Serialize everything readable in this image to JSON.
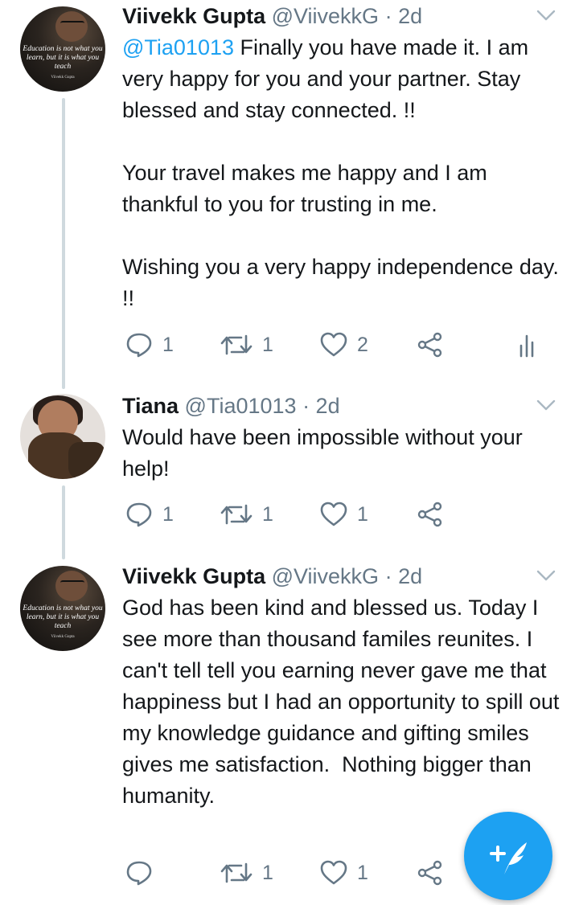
{
  "colors": {
    "accent": "#1da1f2",
    "muted": "#657786",
    "text": "#14171a",
    "thread_line": "#cfd9de"
  },
  "tweets": [
    {
      "name": "Viivekk Gupta",
      "handle": "@ViivekkG",
      "time": "· 2d",
      "mention": "@Tia01013",
      "text": " Finally you have made it. I am very happy for you and your partner. Stay blessed and stay connected. !!\n\nYour travel makes me happy and I am thankful to you for trusting in me.\n\nWishing you a very happy independence day. !!",
      "avatar_quote": "Education is not what you learn, but it is what you teach",
      "avatar_signature": "Viivekk Gupta",
      "replies": "1",
      "retweets": "1",
      "likes": "2",
      "icons": [
        "reply-icon",
        "retweet-icon",
        "like-icon",
        "share-icon",
        "analytics-icon"
      ]
    },
    {
      "name": "Tiana",
      "handle": "@Tia01013",
      "time": "· 2d",
      "text": "Would have been impossible without your help!",
      "replies": "1",
      "retweets": "1",
      "likes": "1",
      "icons": [
        "reply-icon",
        "retweet-icon",
        "like-icon",
        "share-icon"
      ]
    },
    {
      "name": "Viivekk Gupta",
      "handle": "@ViivekkG",
      "time": "· 2d",
      "text": "God has been kind and blessed us. Today I see more than thousand familes reunites. I can't tell tell you earning never gave me that happiness but I had an opportunity to spill out my knowledge guidance and gifting smiles gives me satisfaction.  Nothing bigger than humanity.",
      "avatar_quote": "Education is not what you learn, but it is what you teach",
      "avatar_signature": "Viivekk Gupta",
      "replies": "",
      "retweets": "1",
      "likes": "1",
      "icons": [
        "reply-icon",
        "retweet-icon",
        "like-icon",
        "share-icon"
      ]
    }
  ],
  "compose_button": {
    "icon": "compose-tweet-icon"
  }
}
